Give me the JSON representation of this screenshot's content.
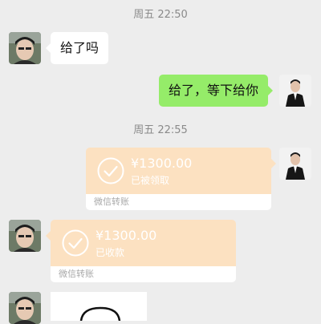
{
  "colors": {
    "background": "#ededed",
    "sent_bubble": "#95ec69",
    "received_bubble": "#ffffff",
    "transfer_card": "#fce1c1"
  },
  "messages": {
    "time_1": "周五 22:50",
    "received_text": "给了吗",
    "sent_text": "给了，等下给你",
    "time_2": "周五 22:55",
    "transfer_sent": {
      "amount": "¥1300.00",
      "status": "已被领取",
      "label": "微信转账",
      "icon": "check-circle-icon"
    },
    "transfer_received": {
      "amount": "¥1300.00",
      "status": "已收款",
      "label": "微信转账",
      "icon": "check-circle-icon"
    }
  }
}
